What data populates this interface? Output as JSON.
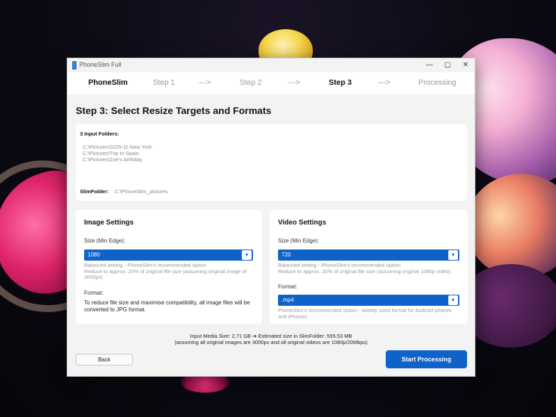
{
  "window": {
    "title": "PhoneSlim Full",
    "controls": {
      "minimize": "—",
      "maximize": "▢",
      "close": "✕"
    }
  },
  "steps": {
    "app_name": "PhoneSlim",
    "step1": "Step 1",
    "arrow1": "--->",
    "step2": "Step 2",
    "arrow2": "--->",
    "step3": "Step 3",
    "arrow3": "--->",
    "processing": "Processing",
    "active": "Step 3"
  },
  "page": {
    "title": "Step 3: Select Resize Targets and Formats"
  },
  "folders": {
    "title": "3 Input Folders:",
    "items": [
      "C:\\Pictures\\2025-11 New York",
      "C:\\Pictures\\Trip to Spain",
      "C:\\Pictures\\Zoe's birthday"
    ],
    "slimfolder_label": "SlimFolder:",
    "slimfolder_value": "C:\\PhoneSlim_pictures"
  },
  "image_settings": {
    "title": "Image Settings",
    "size_label": "Size (Min Edge):",
    "size_value": "1080",
    "size_hint_1": "Balanced setting - PhoneSlim's recommended option",
    "size_hint_2": "Reduce to approx. 20% of original file size (assuming original image of",
    "size_hint_3": "3000px)",
    "format_label": "Format:",
    "format_text_1": "To reduce file size and maximise compatibility, all image files will be",
    "format_text_2": "converted to JPG format."
  },
  "video_settings": {
    "title": "Video Settings",
    "size_label": "Size (Min Edge):",
    "size_value": "720",
    "size_hint_1": "Balanced setting - PhoneSlim's recommended option",
    "size_hint_2": "Reduce to approx. 20% of original file size (assuming original 1080p video)",
    "format_label": "Format:",
    "format_value": ".mp4",
    "format_hint_1": "PhoneSlim's recommended option - Widely used format for Android phones",
    "format_hint_2": "and iPhones"
  },
  "summary": {
    "line1": "Input Media Size: 2.71 GB ➔ Estimated size in SlimFolder: 555.53 MB",
    "line2": "(assuming all original images are 3000px and all original videos are 1080p/20Mbps)"
  },
  "buttons": {
    "back": "Back",
    "start": "Start Processing"
  },
  "icons": {
    "dropdown": "chevron-down-icon",
    "app": "phone-icon"
  },
  "colors": {
    "accent": "#0f62c8",
    "window_bg": "#f3f3f3",
    "card_bg": "#ffffff",
    "muted_text": "#9a9a9a"
  }
}
